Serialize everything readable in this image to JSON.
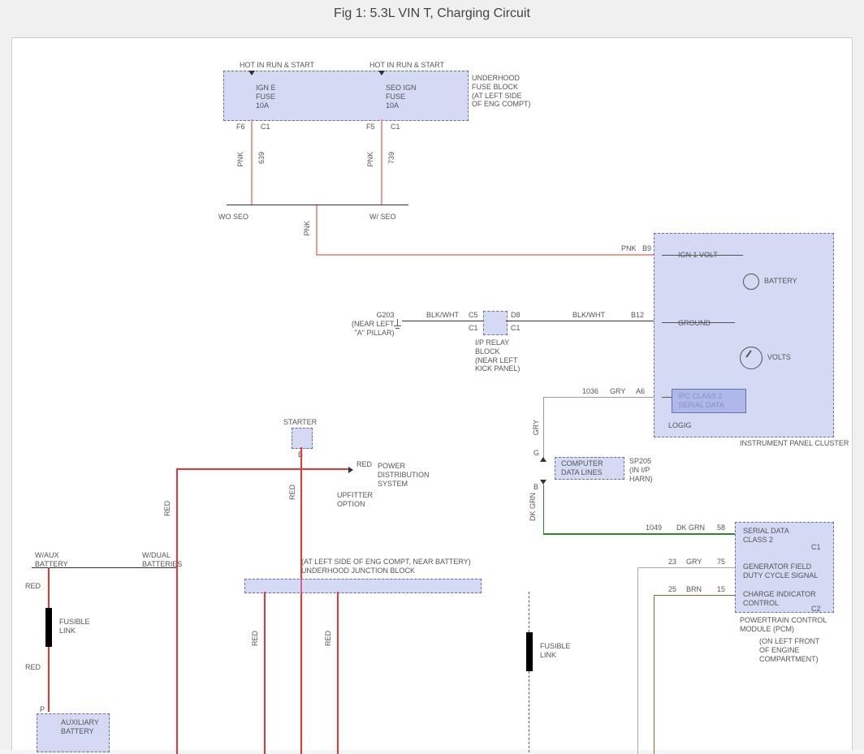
{
  "title": "Fig 1: 5.3L VIN T, Charging Circuit",
  "fuse_block": {
    "hot1": "HOT IN RUN & START",
    "hot2": "HOT IN RUN & START",
    "fuse1": "IGN E\nFUSE\n10A",
    "fuse2": "SEO IGN\nFUSE\n10A",
    "f6": "F6",
    "f5": "F5",
    "c1a": "C1",
    "c1b": "C1",
    "desc": "UNDERHOOD\nFUSE BLOCK\n(AT LEFT SIDE\nOF ENG COMPT)"
  },
  "wires": {
    "pnk": "PNK",
    "num639": "639",
    "num739": "739",
    "blkwht": "BLK/WHT",
    "gry": "GRY",
    "dkgrn": "DK GRN",
    "brn": "BRN",
    "red": "RED",
    "num1036": "1036",
    "num1049": "1049",
    "num23": "23",
    "num25": "25"
  },
  "wo_seo": "WO SEO",
  "w_seo": "W/ SEO",
  "g203": "G203\n(NEAR LEFT\n\"A\" PILLAR)",
  "relay_block": "I/P RELAY\nBLOCK\n(NEAR LEFT\nKICK PANEL)",
  "relay_pins": {
    "c5": "C5",
    "d8": "D8",
    "c1a": "C1",
    "c1b": "C1"
  },
  "ipc": {
    "b9": "B9",
    "b12": "B12",
    "a6": "A6",
    "ign1": "IGN 1 VOLT",
    "battery": "BATTERY",
    "ground": "GROUND",
    "volts": "VOLTS",
    "class2": "IPC CLASS 2\nSERIAL DATA",
    "logic": "LOGIG",
    "name": "INSTRUMENT PANEL CLUSTER"
  },
  "sp205": {
    "box": "COMPUTER\nDATA LINES",
    "label": "SP205\n(IN I/P\nHARN)",
    "g": "G",
    "b": "B"
  },
  "pcm": {
    "p58": "58",
    "p75": "75",
    "p15": "15",
    "c1": "C1",
    "c2": "C2",
    "serial": "SERIAL DATA\nCLASS 2",
    "gen": "GENERATOR FIELD\nDUTY CYCLE SIGNAL",
    "charge": "CHARGE INDICATOR\nCONTROL",
    "name": "POWERTRAIN CONTROL\nMODULE (PCM)",
    "loc": "(ON LEFT FRONT\nOF ENGINE\nCOMPARTMENT)"
  },
  "starter": {
    "label": "STARTER",
    "b": "B"
  },
  "pds": {
    "label": "POWER\nDISTRIBUTION\nSYSTEM",
    "upfitter": "UPFITTER\nOPTION"
  },
  "batteries": {
    "waux": "W/AUX\nBATTERY",
    "wdual": "W/DUAL\nBATTERIES",
    "fusible": "FUSIBLE\nLINK",
    "fusible2": "FUSIBLE\nLINK",
    "aux_relay": "AUXILIARY\nBATTERY\n",
    "p": "P"
  },
  "junction": "(AT LEFT SIDE OF ENG COMPT, NEAR BATTERY)\nUNDERHOOD JUNCTION BLOCK"
}
